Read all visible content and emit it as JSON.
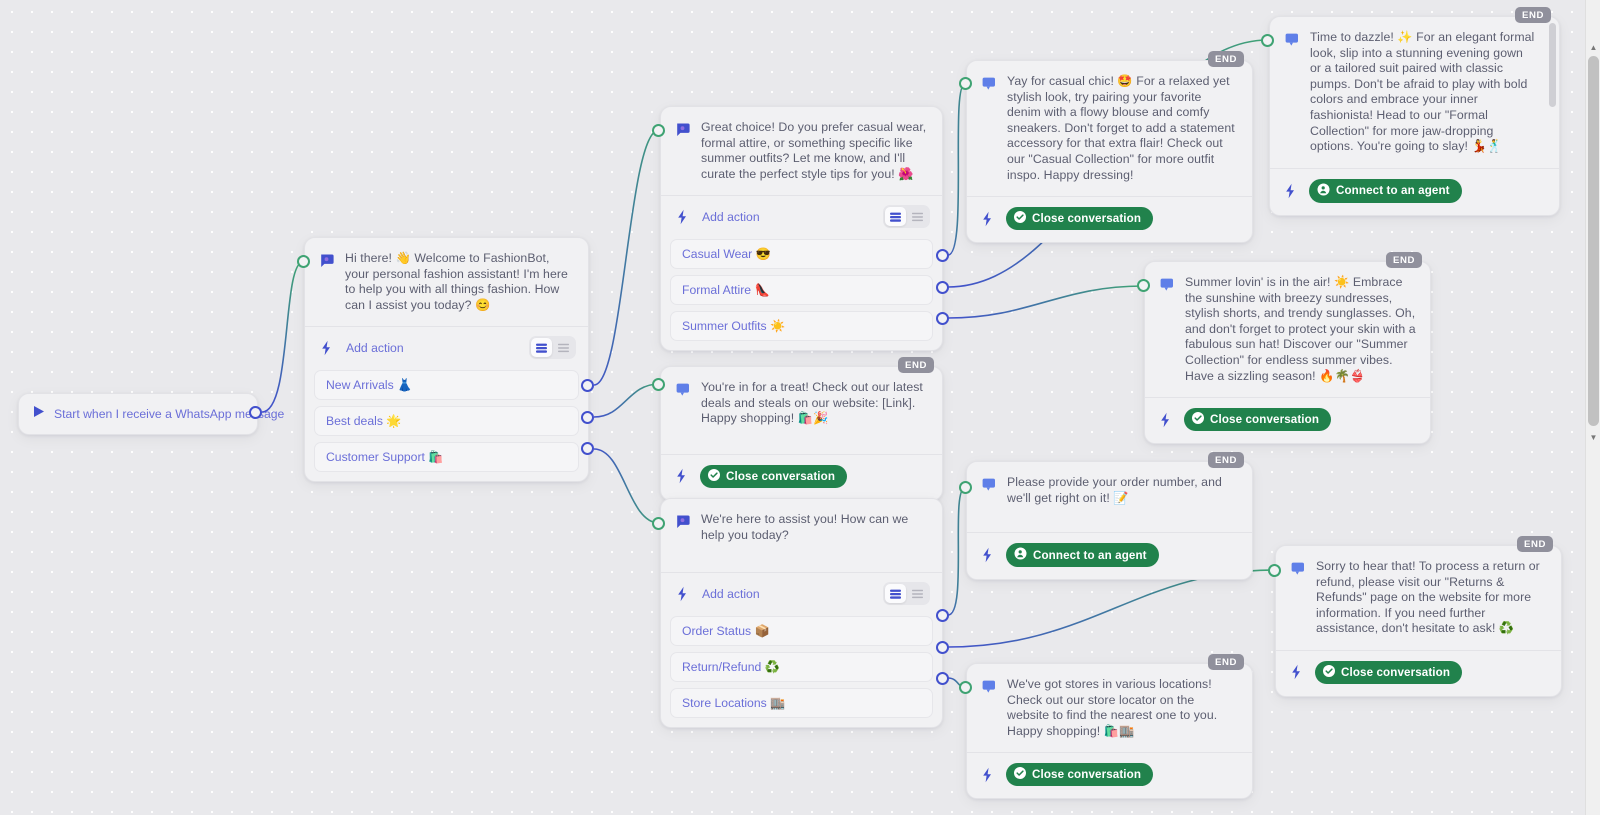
{
  "canvas": {
    "background_color": "#e9e9ec",
    "dot_color": "#ffffff",
    "accent_blue": "#4250cd",
    "accent_green": "#3fa373",
    "pill_green": "#21824c",
    "link_text_color": "#6b6fd8",
    "body_text_color": "#5c5e70",
    "end_badge_color": "#90909c"
  },
  "labels": {
    "add_action": "Add action",
    "end_badge": "END",
    "close_conversation": "Close conversation",
    "connect_to_agent": "Connect to an agent"
  },
  "start_node": {
    "label": "Start when I receive a WhatsApp message",
    "icon": "play-icon"
  },
  "nodes": {
    "welcome": {
      "message": "Hi there! 👋 Welcome to FashionBot, your personal fashion assistant! I'm here to help you with all things fashion. How can I assist you today? 😊",
      "add_action": "Add action",
      "options": [
        {
          "label": "New Arrivals 👗"
        },
        {
          "label": "Best deals 🌟"
        },
        {
          "label": "Customer Support 🛍️"
        }
      ]
    },
    "style_choice": {
      "message": "Great choice! Do you prefer casual wear, formal attire, or something specific like summer outfits? Let me know, and I'll curate the perfect style tips for you! 🌺",
      "add_action": "Add action",
      "options": [
        {
          "label": "Casual Wear 😎"
        },
        {
          "label": "Formal Attire 👠"
        },
        {
          "label": "Summer Outfits ☀️"
        }
      ]
    },
    "casual": {
      "message": "Yay for casual chic! 🤩 For a relaxed yet stylish look, try pairing your favorite denim with a flowy blouse and comfy sneakers. Don't forget to add a statement accessory for that extra flair! Check out our \"Casual Collection\" for more outfit inspo. Happy dressing!",
      "action": "Close conversation",
      "end": "END"
    },
    "formal": {
      "message": "Time to dazzle! ✨ For an elegant formal look, slip into a stunning evening gown or a tailored suit paired with classic pumps. Don't be afraid to play with bold colors and embrace your inner fashionista! Head to our \"Formal Collection\" for more jaw-dropping options. You're going to slay! 💃🕺",
      "action": "Connect to an agent",
      "end": "END"
    },
    "summer": {
      "message": "Summer lovin' is in the air! ☀️ Embrace the sunshine with breezy sundresses, stylish shorts, and trendy sunglasses. Oh, and don't forget to protect your skin with a fabulous sun hat! Discover our \"Summer Collection\" for endless summer vibes. Have a sizzling season! 🔥🌴👙",
      "action": "Close conversation",
      "end": "END"
    },
    "deals": {
      "message": "You're in for a treat! Check out our latest deals and steals on our website: [Link]. Happy shopping! 🛍️🎉",
      "action": "Close conversation",
      "end": "END"
    },
    "support": {
      "message": "We're here to assist you! How can we help you today?",
      "add_action": "Add action",
      "options": [
        {
          "label": "Order Status 📦"
        },
        {
          "label": "Return/Refund ♻️"
        },
        {
          "label": "Store Locations 🏬"
        }
      ]
    },
    "order_status": {
      "message": "Please provide your order number, and we'll get right on it! 📝",
      "action": "Connect to an agent",
      "end": "END"
    },
    "returns": {
      "message": "Sorry to hear that! To process a return or refund, please visit our \"Returns & Refunds\" page on the website for more information. If you need further assistance, don't hesitate to ask! ♻️",
      "action": "Close conversation",
      "end": "END"
    },
    "stores": {
      "message": "We've got stores in various locations! Check out our store locator on the website to find the nearest one to you. Happy shopping! 🛍️🏬",
      "action": "Close conversation",
      "end": "END"
    }
  }
}
